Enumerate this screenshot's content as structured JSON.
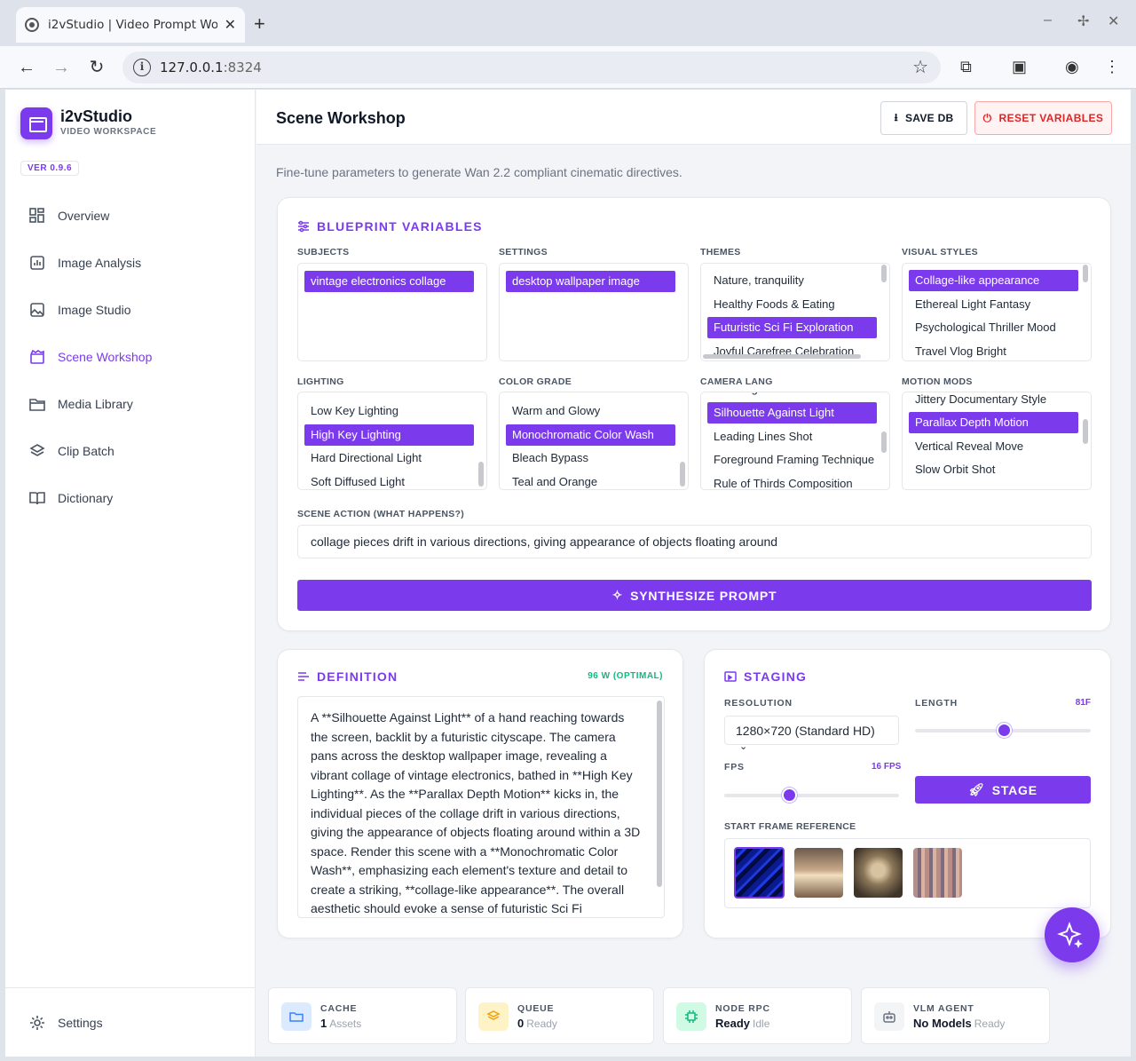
{
  "browser": {
    "tab_title": "i2vStudio | Video Prompt Wor",
    "url_host": "127.0.0.1",
    "url_port": ":8324"
  },
  "sidebar": {
    "brand": "i2vStudio",
    "brand_sub": "VIDEO WORKSPACE",
    "version": "VER 0.9.6",
    "items": [
      {
        "label": "Overview",
        "icon": "grid-icon"
      },
      {
        "label": "Image Analysis",
        "icon": "chart-icon"
      },
      {
        "label": "Image Studio",
        "icon": "image-icon"
      },
      {
        "label": "Scene Workshop",
        "icon": "clapper-icon",
        "active": true
      },
      {
        "label": "Media Library",
        "icon": "folder-icon"
      },
      {
        "label": "Clip Batch",
        "icon": "layers-icon"
      },
      {
        "label": "Dictionary",
        "icon": "book-icon"
      }
    ],
    "settings": "Settings"
  },
  "header": {
    "title": "Scene Workshop",
    "save_label": "SAVE DB",
    "reset_label": "RESET VARIABLES"
  },
  "subtitle": "Fine-tune parameters to generate Wan 2.2 compliant cinematic directives.",
  "blueprint": {
    "title": "BLUEPRINT VARIABLES",
    "lists": [
      {
        "label": "SUBJECTS",
        "options": [
          "vintage electronics collage"
        ]
      },
      {
        "label": "SETTINGS",
        "options": [
          "desktop wallpaper image"
        ]
      },
      {
        "label": "THEMES",
        "options": [
          "Nature, tranquility",
          "Healthy Foods & Eating",
          "Futuristic Sci Fi Exploration",
          "Joyful Carefree Celebration"
        ]
      },
      {
        "label": "VISUAL STYLES",
        "options": [
          "Collage-like appearance",
          "Ethereal Light Fantasy",
          "Psychological Thriller Mood",
          "Travel Vlog Bright"
        ]
      },
      {
        "label": "LIGHTING",
        "options": [
          "Low Key Lighting",
          "High Key Lighting",
          "Hard Directional Light",
          "Soft Diffused Light"
        ]
      },
      {
        "label": "COLOR GRADE",
        "options": [
          "Warm and Glowy",
          "Monochromatic Color Wash",
          "Bleach Bypass",
          "Teal and Orange"
        ]
      },
      {
        "label": "CAMERA LANG",
        "options": [
          "Low Angle Power",
          "Silhouette Against Light",
          "Leading Lines Shot",
          "Foreground Framing Technique",
          "Rule of Thirds Composition"
        ]
      },
      {
        "label": "MOTION MODS",
        "options": [
          "Jittery Documentary Style",
          "Parallax Depth Motion",
          "Vertical Reveal Move",
          "Slow Orbit Shot"
        ]
      }
    ],
    "scene_action_label": "SCENE ACTION (WHAT HAPPENS?)",
    "scene_action_value": "collage pieces drift in various directions, giving appearance of objects floating around",
    "synth_label": "SYNTHESIZE PROMPT"
  },
  "definition": {
    "title": "DEFINITION",
    "word_count": "96 W (OPTIMAL)",
    "text": "A **Silhouette Against Light** of a hand reaching towards the screen, backlit by a futuristic cityscape. The camera pans across the desktop wallpaper image, revealing a vibrant collage of vintage electronics, bathed in **High Key Lighting**.  As the **Parallax Depth Motion** kicks in, the individual pieces of the collage drift in various directions, giving the appearance of objects floating around within a 3D space. Render this scene with a **Monochromatic Color Wash**, emphasizing each element's texture and detail to create a striking, **collage-like appearance**. The overall aesthetic should evoke a sense of futuristic Sci Fi"
  },
  "staging": {
    "title": "STAGING",
    "resolution_label": "RESOLUTION",
    "resolution_value": "1280×720 (Standard HD)",
    "length_label": "LENGTH",
    "length_value": "81F",
    "length_fraction": 0.51,
    "fps_label": "FPS",
    "fps_value": "16 FPS",
    "fps_fraction": 0.375,
    "stage_label": "STAGE",
    "start_frame_label": "START FRAME REFERENCE"
  },
  "status": [
    {
      "label": "CACHE",
      "value": "1",
      "sub": "Assets",
      "icon": "folder-icon",
      "color": "#dbeafe"
    },
    {
      "label": "QUEUE",
      "value": "0",
      "sub": "Ready",
      "icon": "stack-icon",
      "color": "#fef3c7"
    },
    {
      "label": "NODE RPC",
      "value": "Ready",
      "sub": "Idle",
      "icon": "cpu-icon",
      "color": "#d1fae5"
    },
    {
      "label": "VLM AGENT",
      "value": "No Models",
      "sub": "Ready",
      "icon": "robot-icon",
      "color": "#f3f4f6"
    }
  ],
  "colors": {
    "accent": "#7c3aed",
    "danger": "#dc2626",
    "success": "#10b981"
  }
}
